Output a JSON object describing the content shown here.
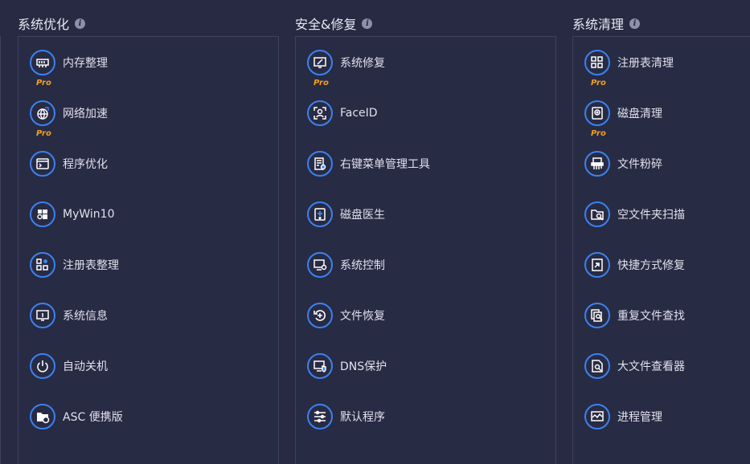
{
  "sections": [
    {
      "title": "系统优化",
      "tools": [
        {
          "label": "内存整理",
          "icon": "memory-chip-icon",
          "pro": "Pro"
        },
        {
          "label": "网络加速",
          "icon": "globe-rocket-icon",
          "pro": "Pro"
        },
        {
          "label": "程序优化",
          "icon": "window-program-icon",
          "pro": ""
        },
        {
          "label": "MyWin10",
          "icon": "windows-gear-icon",
          "pro": ""
        },
        {
          "label": "注册表整理",
          "icon": "registry-grid-icon",
          "pro": ""
        },
        {
          "label": "系统信息",
          "icon": "monitor-info-icon",
          "pro": ""
        },
        {
          "label": "自动关机",
          "icon": "power-icon",
          "pro": ""
        },
        {
          "label": "ASC 便携版",
          "icon": "portable-folder-icon",
          "pro": ""
        }
      ]
    },
    {
      "title": "安全&修复",
      "tools": [
        {
          "label": "系统修复",
          "icon": "monitor-repair-icon",
          "pro": "Pro"
        },
        {
          "label": "FaceID",
          "icon": "face-id-icon",
          "pro": ""
        },
        {
          "label": "右键菜单管理工具",
          "icon": "context-menu-icon",
          "pro": ""
        },
        {
          "label": "磁盘医生",
          "icon": "disk-doctor-icon",
          "pro": ""
        },
        {
          "label": "系统控制",
          "icon": "system-control-icon",
          "pro": ""
        },
        {
          "label": "文件恢复",
          "icon": "file-recovery-icon",
          "pro": ""
        },
        {
          "label": "DNS保护",
          "icon": "dns-shield-icon",
          "pro": ""
        },
        {
          "label": "默认程序",
          "icon": "sliders-icon",
          "pro": ""
        }
      ]
    },
    {
      "title": "系统清理",
      "tools": [
        {
          "label": "注册表清理",
          "icon": "registry-clean-icon",
          "pro": "Pro"
        },
        {
          "label": "磁盘清理",
          "icon": "disk-clean-icon",
          "pro": "Pro"
        },
        {
          "label": "文件粉碎",
          "icon": "file-shredder-icon",
          "pro": ""
        },
        {
          "label": "空文件夹扫描",
          "icon": "empty-folder-scan-icon",
          "pro": ""
        },
        {
          "label": "快捷方式修复",
          "icon": "shortcut-fix-icon",
          "pro": ""
        },
        {
          "label": "重复文件查找",
          "icon": "duplicate-file-icon",
          "pro": ""
        },
        {
          "label": "大文件查看器",
          "icon": "large-file-icon",
          "pro": ""
        },
        {
          "label": "进程管理",
          "icon": "process-monitor-icon",
          "pro": ""
        }
      ]
    }
  ],
  "info_icon": "i",
  "colors": {
    "background": "#272a42",
    "accent": "#3b82f0",
    "pro": "#f0a020",
    "border": "#3e4260"
  }
}
